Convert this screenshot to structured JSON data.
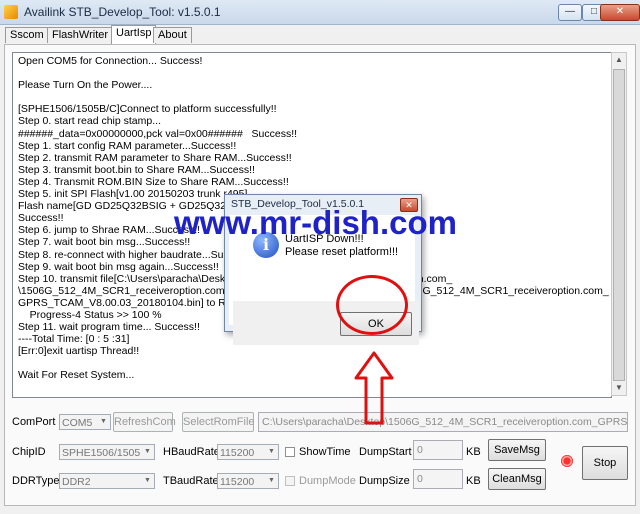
{
  "window": {
    "title": "Availink STB_Develop_Tool: v1.5.0.1",
    "minimize": "—",
    "maximize": "□",
    "close": "✕"
  },
  "tabs": [
    {
      "label": "Sscom",
      "active": false
    },
    {
      "label": "FlashWriter",
      "active": false
    },
    {
      "label": "UartIsp",
      "active": true
    },
    {
      "label": "About",
      "active": false
    }
  ],
  "log": [
    "Open COM5 for Connection... Success!",
    "",
    "Please Turn On the Power....",
    "",
    "[SPHE1506/1505B/C]Connect to platform successfully!!",
    "Step 0. start read chip stamp...",
    "######_data=0x00000000,pck val=0x00######   Success!!",
    "Step 1. start config RAM parameter...Success!!",
    "Step 2. transmit RAM parameter to Share RAM...Success!!",
    "Step 3. transmit boot.bin to Share RAM...Success!!",
    "Step 4. Transmit ROM.BIN Size to Share RAM...Success!!",
    "Step 5. init SPI Flash[v1.00 20150203 trunk r495]",
    "Flash name[GD GD25Q32BSIG + GD25Q32CSIG] flash type/size/ID=0x1640c80311",
    "Success!!",
    "Step 6. jump to Shrae RAM...Success!!",
    "Step 7. wait boot bin msg...Success!!",
    "Step 8. re-connect with higher baudrate...Success!!",
    "Step 9. wait boot bin msg again...Success!!",
    "Step 10. transmit file[C:\\Users\\paracha\\Desktop\\1506G_512_4M_SCR1_receiveroption.com_",
    "\\1506G_512_4M_SCR1_receiveroption.com_GPRS_TCAM_V8.00.03_20180104\\1506G_512_4M_SCR1_receiveroption.com_",
    "GPRS_TCAM_V8.00.03_20180104.bin] to RAM...",
    "    Progress-4 Status >> 100 %",
    "Step 11. wait program time... Success!!",
    "----Total Time: [0 : 5 :31]",
    "[Err:0]exit uartisp Thread!!",
    "",
    "Wait For Reset System..."
  ],
  "controls": {
    "comport_label": "ComPort",
    "comport_value": "COM5",
    "refresh_label": "RefreshCom",
    "select_rom_label": "SelectRomFile",
    "rom_path": "C:\\Users\\paracha\\Desktop\\1506G_512_4M_SCR1_receiveroption.com_GPRS_TCAM",
    "chipid_label": "ChipID",
    "chipid_value": "SPHE1506/1505",
    "hbaud_label": "HBaudRate",
    "hbaud_value": "115200",
    "showtime_label": "ShowTime",
    "dumpstart_label": "DumpStart",
    "dumpstart_value": "0",
    "kb1": "KB",
    "savemsg_label": "SaveMsg",
    "stop_label": "Stop",
    "ddrtype_label": "DDRType",
    "ddrtype_value": "DDR2",
    "tbaud_label": "TBaudRate",
    "tbaud_value": "115200",
    "dumpmode_label": "DumpMode",
    "dumpsize_label": "DumpSize",
    "dumpsize_value": "0",
    "kb2": "KB",
    "cleanmsg_label": "CleanMsg"
  },
  "dialog": {
    "title": "STB_Develop_Tool_v1.5.0.1",
    "close": "✕",
    "line1": "UartISP Down!!!",
    "line2": "Please reset platform!!!",
    "ok_label": "OK"
  },
  "watermark": "www.mr-dish.com",
  "colors": {
    "watermark": "#1e22c8",
    "annotation": "#e01010"
  }
}
